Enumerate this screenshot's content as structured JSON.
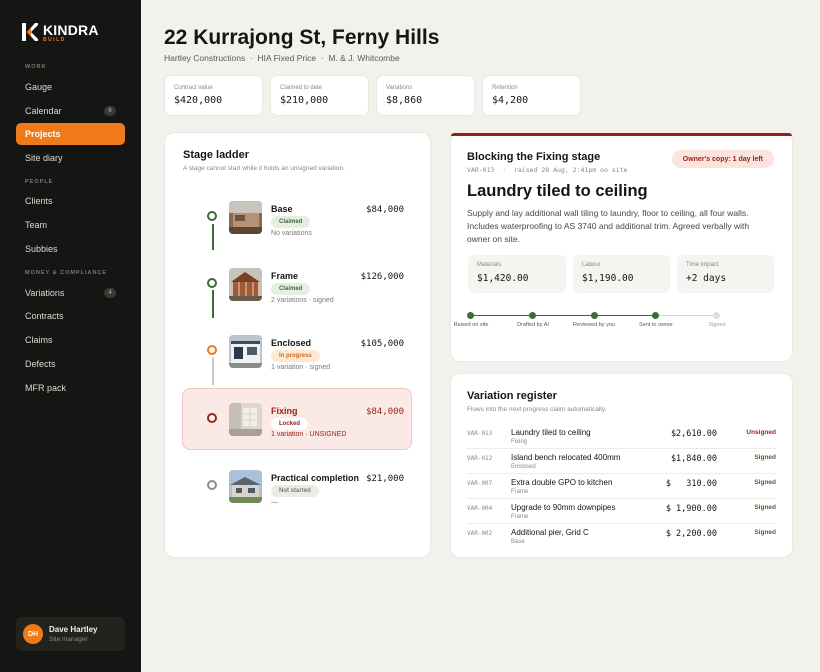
{
  "app": {
    "brand": "KINDRA",
    "brand_sub": "BUILD"
  },
  "sidebar": {
    "sections": [
      {
        "label": "WORK"
      },
      {
        "label": "PEOPLE"
      },
      {
        "label": "MONEY & COMPLIANCE"
      }
    ],
    "items": [
      {
        "label": "Gauge"
      },
      {
        "label": "Calendar",
        "badge": "6"
      },
      {
        "label": "Projects",
        "active": true
      },
      {
        "label": "Site diary"
      },
      {
        "label": "Clients"
      },
      {
        "label": "Team"
      },
      {
        "label": "Subbies"
      },
      {
        "label": "Variations",
        "badge": "4"
      },
      {
        "label": "Contracts"
      },
      {
        "label": "Claims"
      },
      {
        "label": "Defects"
      },
      {
        "label": "MFR pack"
      }
    ],
    "user": {
      "initials": "DH",
      "name": "Dave Hartley",
      "role": "Site manager"
    }
  },
  "header": {
    "title": "22 Kurrajong St, Ferny Hills",
    "subtitle": "Hartley Constructions  ·  HIA Fixed Price  ·  M. & J. Whitcombe"
  },
  "stats": [
    {
      "label": "Contract value",
      "value": "$420,000"
    },
    {
      "label": "Claimed to date",
      "value": "$210,000"
    },
    {
      "label": "Variations",
      "value": "$8,860"
    },
    {
      "label": "Retention",
      "value": "$4,200"
    }
  ],
  "ladder": {
    "title": "Stage ladder",
    "subtitle": "A stage cannot start while it holds an unsigned variation.",
    "stages": [
      {
        "name": "Base",
        "status": "Claimed",
        "note": "No variations",
        "amount": "$84,000"
      },
      {
        "name": "Frame",
        "status": "Claimed",
        "note": "2 variations · signed",
        "amount": "$126,000"
      },
      {
        "name": "Enclosed",
        "status": "In progress",
        "note": "1 variation · signed",
        "amount": "$105,000"
      },
      {
        "name": "Fixing",
        "status": "Locked",
        "note": "1 variation · UNSIGNED",
        "amount": "$84,000"
      },
      {
        "name": "Practical completion",
        "status": "Not started",
        "note": "—",
        "amount": "$21,000"
      }
    ]
  },
  "blocking": {
    "title": "Blocking the Fixing stage",
    "meta": "VAR-013  ·  raised 28 Aug, 2:41pm on site",
    "owner_copy": "Owner's copy: 1 day left",
    "heading": "Laundry tiled to ceiling",
    "description": "Supply and lay additional wall tiling to laundry, floor to ceiling, all four walls. Includes waterproofing to AS 3740 and additional trim. Agreed verbally with owner on site.",
    "figures": [
      {
        "label": "Materials",
        "value": "$1,420.00"
      },
      {
        "label": "Labour",
        "value": "$1,190.00"
      },
      {
        "label": "Time impact",
        "value": "+2 days"
      }
    ],
    "steps": [
      {
        "label": "Raised on site",
        "done": true
      },
      {
        "label": "Drafted by AI",
        "done": true
      },
      {
        "label": "Reviewed by you",
        "done": true
      },
      {
        "label": "Sent to owner",
        "done": true
      },
      {
        "label": "Signed",
        "done": false
      }
    ]
  },
  "register": {
    "title": "Variation register",
    "subtitle": "Flows into the next progress claim automatically.",
    "rows": [
      {
        "id": "VAR-013",
        "title": "Laundry tiled to ceiling",
        "stage": "Fixing",
        "amount": "$2,610.00",
        "status": "Unsigned"
      },
      {
        "id": "VAR-012",
        "title": "Island bench relocated 400mm",
        "stage": "Enclosed",
        "amount": "$1,840.00",
        "status": "Signed"
      },
      {
        "id": "VAR-007",
        "title": "Extra double GPO to kitchen",
        "stage": "Frame",
        "amount": "$   310.00",
        "status": "Signed"
      },
      {
        "id": "VAR-004",
        "title": "Upgrade to 90mm downpipes",
        "stage": "Frame",
        "amount": "$ 1,900.00",
        "status": "Signed"
      },
      {
        "id": "VAR-002",
        "title": "Additional pier, Grid C",
        "stage": "Base",
        "amount": "$ 2,200.00",
        "status": "Signed"
      }
    ]
  }
}
